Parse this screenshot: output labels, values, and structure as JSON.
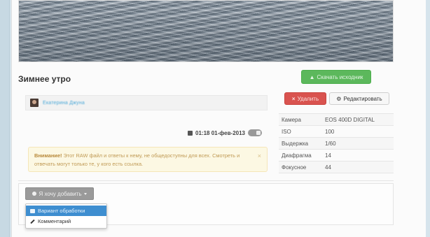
{
  "photo": {
    "title": "Зимнее утро"
  },
  "actions": {
    "download_label": "Скачать исходник",
    "delete_label": "Удалить",
    "edit_label": "Редактировать"
  },
  "author": {
    "name": "Екатерина Джуна"
  },
  "meta": {
    "datetime": "01:18 01-фев-2013"
  },
  "warning": {
    "strong": "Внимание!",
    "text": " Этот RAW файл и ответы к нему, не общедоступны для всех. Смотреть и отвечать могут только те, у кого есть ссылка.",
    "close": "×"
  },
  "specs": [
    {
      "key": "Камера",
      "value": "EOS 400D DIGITAL"
    },
    {
      "key": "ISO",
      "value": "100"
    },
    {
      "key": "Выдержка",
      "value": "1/60"
    },
    {
      "key": "Диафрагма",
      "value": "14"
    },
    {
      "key": "Фокусное",
      "value": "44"
    }
  ],
  "add_menu": {
    "button_label": "Я хочу добавить",
    "items": [
      {
        "label": "Вариант обработки",
        "icon": "image-icon",
        "active": true
      },
      {
        "label": "Комментарий",
        "icon": "pencil-icon",
        "active": false
      }
    ]
  },
  "colors": {
    "download": "#5cb85c",
    "delete": "#d9534f",
    "dropdown_active": "#3e8ed0",
    "author_link": "#4aa8d8"
  }
}
